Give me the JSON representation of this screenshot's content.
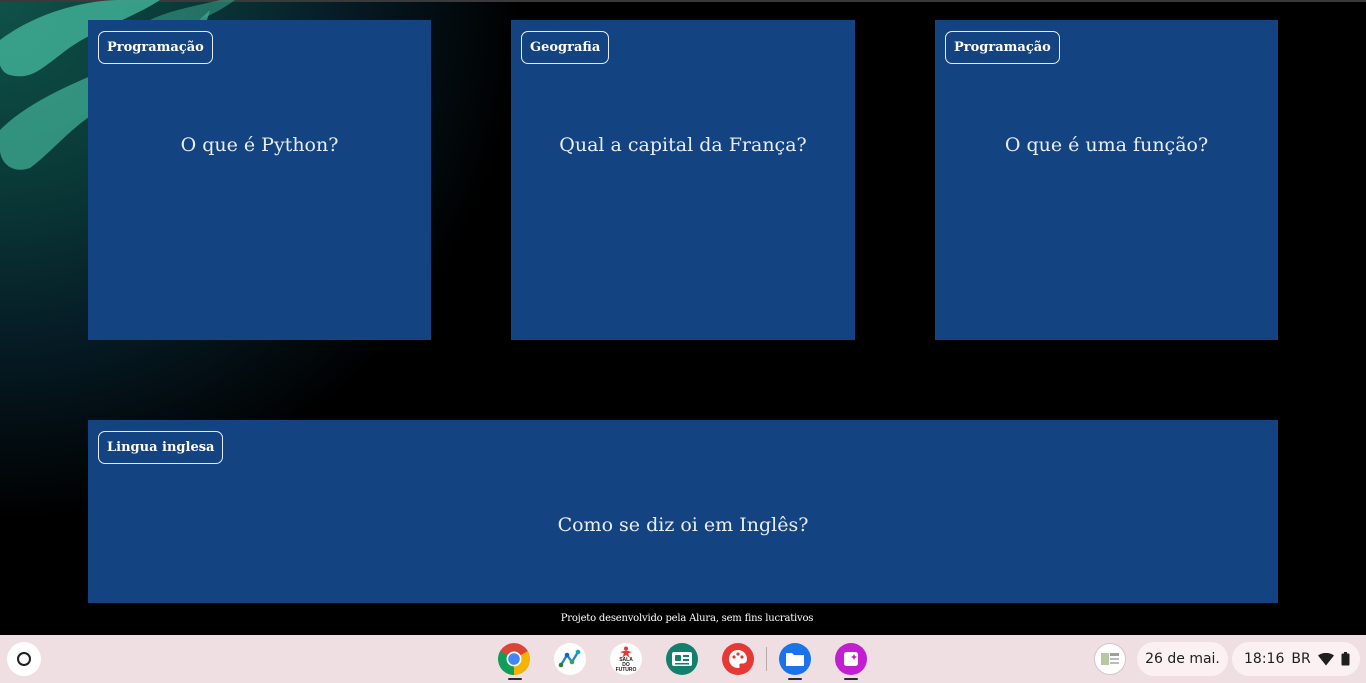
{
  "cards": [
    {
      "category": "Programação",
      "question": "O que é Python?"
    },
    {
      "category": "Geografia",
      "question": "Qual a capital da França?"
    },
    {
      "category": "Programação",
      "question": "O que é uma função?"
    },
    {
      "category": "Lingua inglesa",
      "question": "Como se diz oi em Inglês?"
    }
  ],
  "footer": {
    "text": "Projeto desenvolvido pela Alura, sem fins lucrativos"
  },
  "shelf": {
    "date": "26 de mai.",
    "time": "18:16",
    "input_method": "BR",
    "apps": [
      {
        "name": "chrome-icon"
      },
      {
        "name": "network-app-icon"
      },
      {
        "name": "sala-do-futuro-icon",
        "label": "SALA DO FUTURO"
      },
      {
        "name": "classroom-app-icon"
      },
      {
        "name": "canvas-paint-icon"
      },
      {
        "name": "files-icon"
      },
      {
        "name": "screencast-icon"
      }
    ]
  },
  "colors": {
    "card_bg": "#144382",
    "shelf_bg": "#efdfe3",
    "page_bg": "#000000"
  }
}
